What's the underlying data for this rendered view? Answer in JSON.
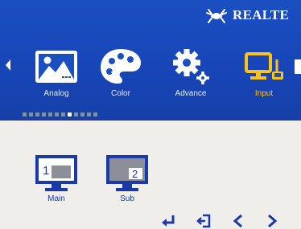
{
  "brand": {
    "name": "REALTE",
    "logo_icon": "realtek-crab-logo-icon"
  },
  "tabs": [
    {
      "label": "Analog",
      "icon": "image-icon",
      "active": false
    },
    {
      "label": "Color",
      "icon": "palette-icon",
      "active": false
    },
    {
      "label": "Advance",
      "icon": "gears-icon",
      "active": false
    },
    {
      "label": "Input",
      "icon": "input-monitor-icon",
      "active": true
    }
  ],
  "pager": {
    "count": 12,
    "active_index": 7
  },
  "sources": [
    {
      "label": "Main",
      "number": "1"
    },
    {
      "label": "Sub",
      "number": "2"
    }
  ],
  "bottom_keys": [
    {
      "icon": "enter-icon"
    },
    {
      "icon": "exit-icon"
    },
    {
      "icon": "left-icon",
      "glyph": "<"
    },
    {
      "icon": "right-icon",
      "glyph": ">"
    }
  ],
  "colors": {
    "osd_blue": "#1a4fc2",
    "active_tab": "#ffc21a",
    "background": "#efeeea",
    "source_blue": "#1a3aa8"
  }
}
